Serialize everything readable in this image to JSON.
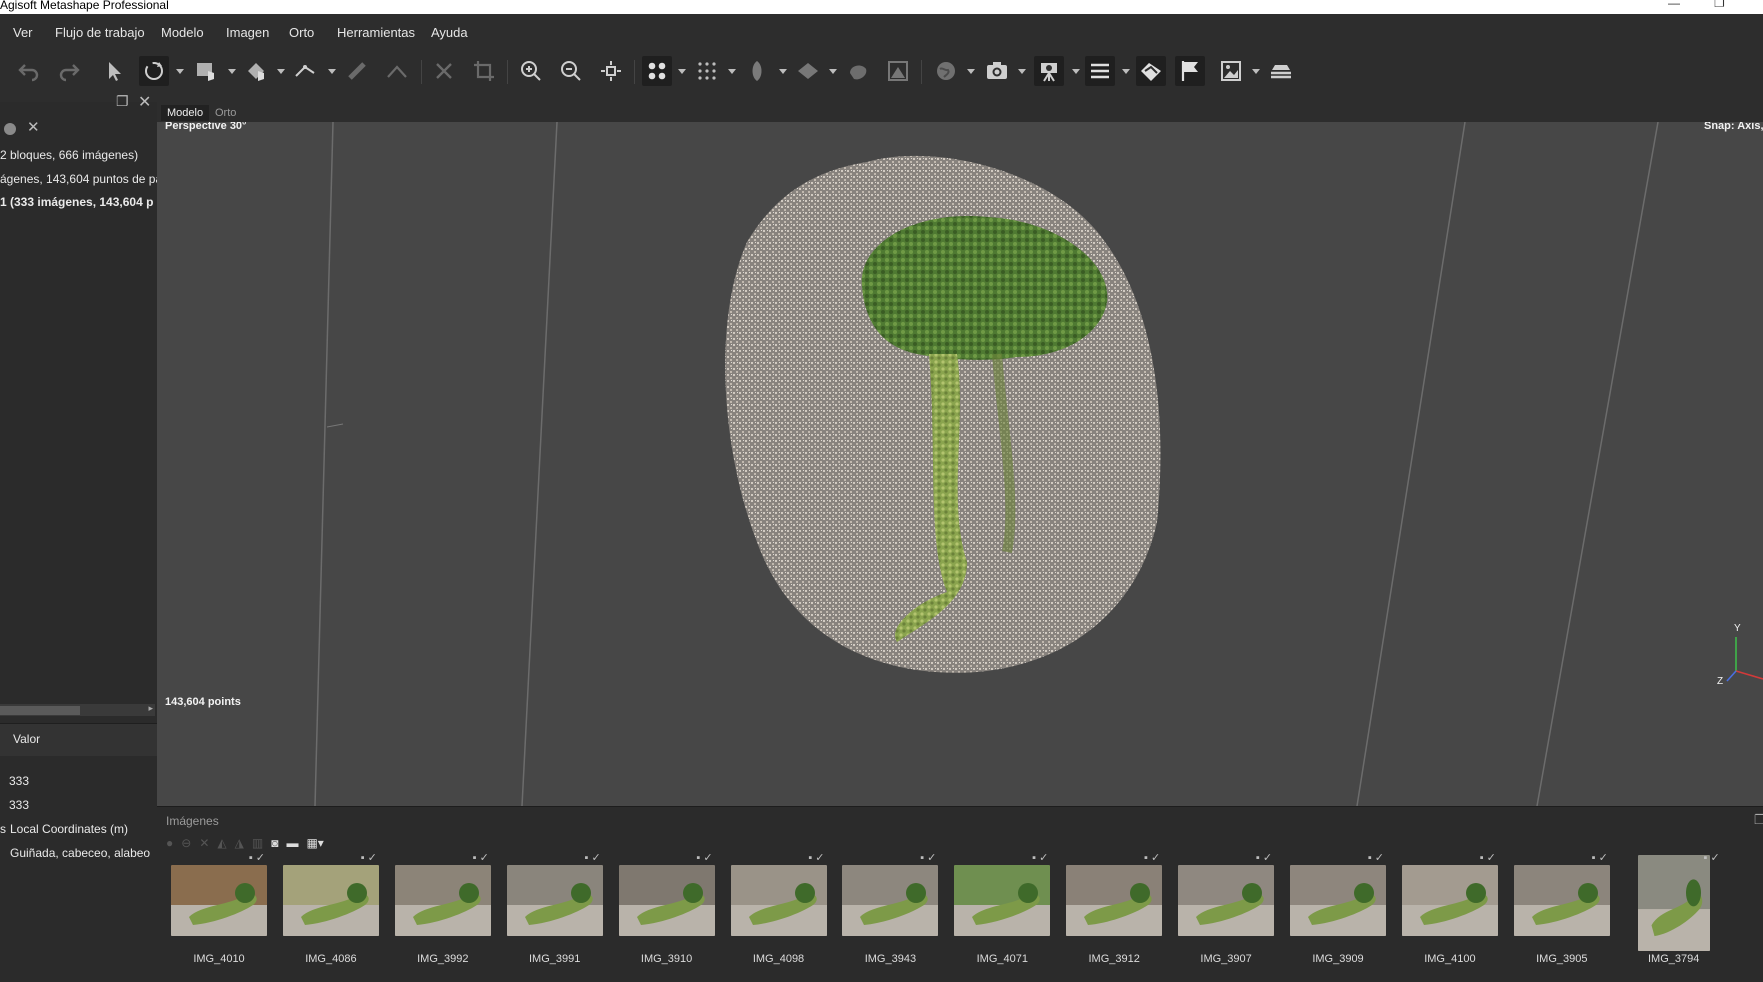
{
  "window": {
    "title": "Agisoft Metashape Professional"
  },
  "menu": [
    "Ver",
    "Flujo de trabajo",
    "Modelo",
    "Imagen",
    "Orto",
    "Herramientas",
    "Ayuda"
  ],
  "toolbar": {
    "icons": [
      "undo-icon",
      "redo-icon",
      "select-arrow-icon",
      "rotate-region-icon",
      "rectangle-select-icon",
      "paint-select-icon",
      "ruler-icon",
      "shape-icon",
      "delete-icon",
      "crop-icon",
      "zoom-in-icon",
      "zoom-out-icon",
      "reset-view-icon",
      "point-cloud-icon",
      "dense-cloud-icon",
      "mesh-icon",
      "textured-icon",
      "tiled-icon",
      "dem-icon",
      "globe-icon",
      "camera-icon",
      "camera-settings-icon",
      "list-icon",
      "shape-layer-icon",
      "flag-icon",
      "image-icon",
      "layers-icon"
    ]
  },
  "workspace": {
    "rows": [
      "2 bloques, 666 imágenes)",
      "ágenes, 143,604 puntos de pa",
      "1 (333 imágenes, 143,604 p"
    ],
    "props_header": "Valor",
    "props": [
      "333",
      "333",
      "Local Coordinates (m)",
      "Guiñada, cabeceo, alabeo"
    ],
    "props_prefix": "s"
  },
  "tabs": [
    "Modelo",
    "Orto"
  ],
  "viewport": {
    "projection": "Perspective 30°",
    "snap": "Snap: Axis,",
    "points": "143,604 points",
    "axes": {
      "y": "Y",
      "z": "Z"
    }
  },
  "images_panel": {
    "title": "Imágenes",
    "thumbnails": [
      "IMG_4010",
      "IMG_4086",
      "IMG_3992",
      "IMG_3991",
      "IMG_3910",
      "IMG_4098",
      "IMG_3943",
      "IMG_4071",
      "IMG_3912",
      "IMG_3907",
      "IMG_3909",
      "IMG_4100",
      "IMG_3905",
      "IMG_3794"
    ]
  },
  "colors": {
    "background": "#2b2b2b",
    "viewport": "#474747",
    "broccoli": "#5f8a3a",
    "cloud": "#d8cfc4"
  }
}
